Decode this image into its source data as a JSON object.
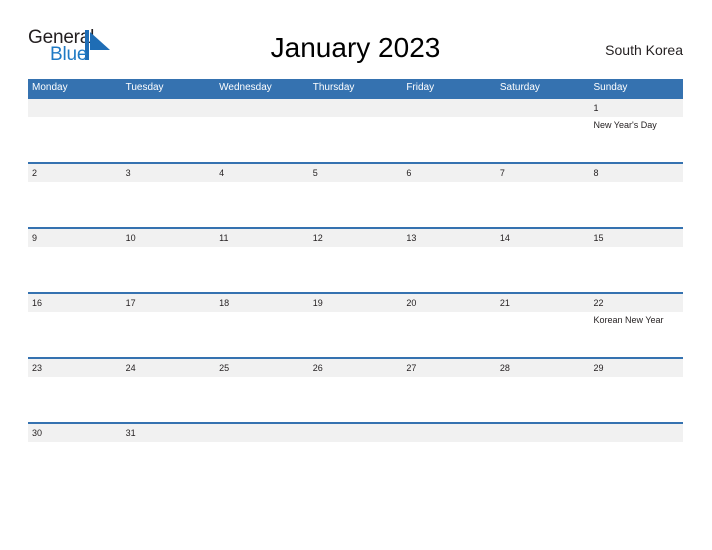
{
  "brand": {
    "name_part1": "General",
    "name_part2": "Blue",
    "mark_icon": "blue-sail-triangle-icon",
    "color_primary": "#1f7ac4",
    "color_text": "#231f20"
  },
  "header": {
    "title": "January 2023",
    "region": "South Korea"
  },
  "theme": {
    "header_blue": "#3572b0",
    "row_divider_blue": "#3572b0",
    "date_band_gray": "#f1f1f1",
    "page_background": "#ffffff"
  },
  "calendar": {
    "month": "January",
    "year": "2023",
    "weekday_headers": [
      "Monday",
      "Tuesday",
      "Wednesday",
      "Thursday",
      "Friday",
      "Saturday",
      "Sunday"
    ],
    "weeks": [
      {
        "days": [
          {
            "num": "",
            "event": ""
          },
          {
            "num": "",
            "event": ""
          },
          {
            "num": "",
            "event": ""
          },
          {
            "num": "",
            "event": ""
          },
          {
            "num": "",
            "event": ""
          },
          {
            "num": "",
            "event": ""
          },
          {
            "num": "1",
            "event": "New Year's Day"
          }
        ]
      },
      {
        "days": [
          {
            "num": "2",
            "event": ""
          },
          {
            "num": "3",
            "event": ""
          },
          {
            "num": "4",
            "event": ""
          },
          {
            "num": "5",
            "event": ""
          },
          {
            "num": "6",
            "event": ""
          },
          {
            "num": "7",
            "event": ""
          },
          {
            "num": "8",
            "event": ""
          }
        ]
      },
      {
        "days": [
          {
            "num": "9",
            "event": ""
          },
          {
            "num": "10",
            "event": ""
          },
          {
            "num": "11",
            "event": ""
          },
          {
            "num": "12",
            "event": ""
          },
          {
            "num": "13",
            "event": ""
          },
          {
            "num": "14",
            "event": ""
          },
          {
            "num": "15",
            "event": ""
          }
        ]
      },
      {
        "days": [
          {
            "num": "16",
            "event": ""
          },
          {
            "num": "17",
            "event": ""
          },
          {
            "num": "18",
            "event": ""
          },
          {
            "num": "19",
            "event": ""
          },
          {
            "num": "20",
            "event": ""
          },
          {
            "num": "21",
            "event": ""
          },
          {
            "num": "22",
            "event": "Korean New Year"
          }
        ]
      },
      {
        "days": [
          {
            "num": "23",
            "event": ""
          },
          {
            "num": "24",
            "event": ""
          },
          {
            "num": "25",
            "event": ""
          },
          {
            "num": "26",
            "event": ""
          },
          {
            "num": "27",
            "event": ""
          },
          {
            "num": "28",
            "event": ""
          },
          {
            "num": "29",
            "event": ""
          }
        ]
      },
      {
        "days": [
          {
            "num": "30",
            "event": ""
          },
          {
            "num": "31",
            "event": ""
          },
          {
            "num": "",
            "event": ""
          },
          {
            "num": "",
            "event": ""
          },
          {
            "num": "",
            "event": ""
          },
          {
            "num": "",
            "event": ""
          },
          {
            "num": "",
            "event": ""
          }
        ]
      }
    ]
  }
}
